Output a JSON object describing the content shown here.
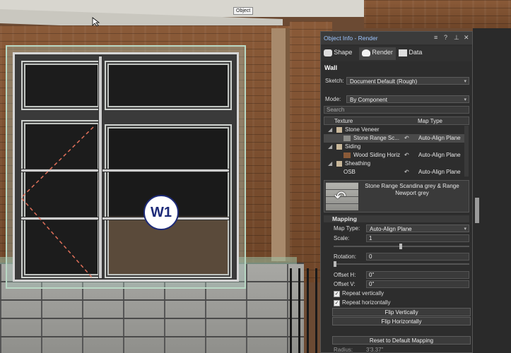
{
  "viewport": {
    "object_tag": "Object",
    "window_label": "W1"
  },
  "panel": {
    "title": "Object Info - Render",
    "tabs": [
      {
        "label": "Shape",
        "icon": "shape-icon"
      },
      {
        "label": "Render",
        "icon": "teapot-icon"
      },
      {
        "label": "Data",
        "icon": "data-icon"
      }
    ],
    "object_type": "Wall",
    "sketch_label": "Sketch:",
    "sketch_value": "Document Default (Rough)",
    "mode_label": "Mode:",
    "mode_value": "By Component",
    "search_placeholder": "Search",
    "columns": {
      "texture": "Texture",
      "map_type": "Map Type"
    },
    "tree": [
      {
        "label": "Stone Veneer",
        "type": "group",
        "map": ""
      },
      {
        "label": "Stone Range Sc...",
        "type": "item",
        "map": "Auto-Align Plane",
        "selected": true,
        "swatch": "#8c8c88"
      },
      {
        "label": "Siding",
        "type": "group",
        "map": ""
      },
      {
        "label": "Wood Siding Horiz",
        "type": "item",
        "map": "Auto-Align Plane",
        "swatch": "#8a5a38"
      },
      {
        "label": "Sheathing",
        "type": "group",
        "map": ""
      },
      {
        "label": "OSB",
        "type": "item",
        "map": "Auto-Align Plane",
        "swatch": "#b08a55"
      }
    ],
    "preview_name": "Stone Range Scandina grey & Range Newport grey",
    "mapping_title": "Mapping",
    "map_type_label": "Map Type:",
    "map_type_value": "Auto-Align Plane",
    "scale_label": "Scale:",
    "scale_value": "1",
    "rotation_label": "Rotation:",
    "rotation_value": "0",
    "offset_h_label": "Offset H:",
    "offset_h_value": "0\"",
    "offset_v_label": "Offset V:",
    "offset_v_value": "0\"",
    "repeat_v_label": "Repeat vertically",
    "repeat_h_label": "Repeat horizontally",
    "flip_v_label": "Flip Vertically",
    "flip_h_label": "Flip Horizontally",
    "reset_label": "Reset to Default Mapping",
    "radius_label": "Radius:",
    "radius_value": "3'3.37\"",
    "title_buttons": [
      "≡",
      "?",
      "⊥",
      "✕"
    ]
  }
}
